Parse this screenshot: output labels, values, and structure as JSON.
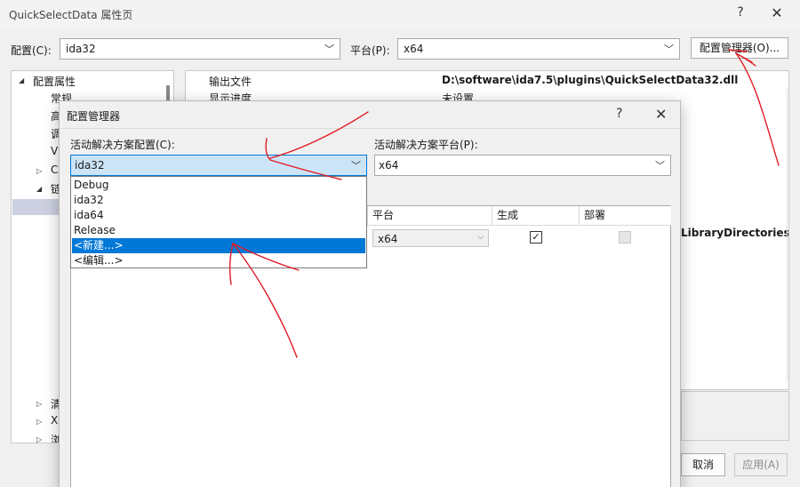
{
  "window": {
    "title": "QuickSelectData 属性页",
    "help_glyph": "?",
    "close_glyph": "✕"
  },
  "config_row": {
    "config_label": "配置(C):",
    "config_value": "ida32",
    "platform_label": "平台(P):",
    "platform_value": "x64",
    "manager_button": "配置管理器(O)..."
  },
  "tree": {
    "items": [
      {
        "label": "配置属性",
        "arrow": "◢"
      },
      {
        "label": "常规",
        "arrow": ""
      },
      {
        "label": "高",
        "arrow": ""
      },
      {
        "label": "调",
        "arrow": ""
      },
      {
        "label": "V",
        "arrow": ""
      },
      {
        "label": "C",
        "arrow": "▷"
      },
      {
        "label": "链",
        "arrow": "◢"
      },
      {
        "label": "清",
        "arrow": "▷"
      },
      {
        "label": "X",
        "arrow": "▷"
      },
      {
        "label": "浏",
        "arrow": "▷"
      }
    ]
  },
  "grid": {
    "rows": [
      {
        "name": "输出文件",
        "value": "D:\\software\\ida7.5\\plugins\\QuickSelectData32.dll"
      },
      {
        "name": "显示进度",
        "value": "未设置"
      }
    ],
    "partial_value": "LibraryDirectories)"
  },
  "buttons": {
    "cancel": "取消",
    "apply": "应用(A)"
  },
  "config_manager": {
    "title": "配置管理器",
    "help_glyph": "?",
    "close_glyph": "✕",
    "active_config_label": "活动解决方案配置(C):",
    "active_config_value": "ida32",
    "active_platform_label": "活动解决方案平台(P):",
    "active_platform_value": "x64",
    "columns": [
      "平台",
      "生成",
      "部署"
    ],
    "row": {
      "platform": "x64",
      "build_checked": "✓"
    },
    "dropdown": {
      "options": [
        "Debug",
        "ida32",
        "ida64",
        "Release",
        "<新建...>",
        "<编辑...>"
      ],
      "selected_index": 4
    }
  },
  "colors": {
    "accent": "#0078d7",
    "annotation": "#e01b24",
    "combo_focus_bg": "#cce4f7"
  }
}
